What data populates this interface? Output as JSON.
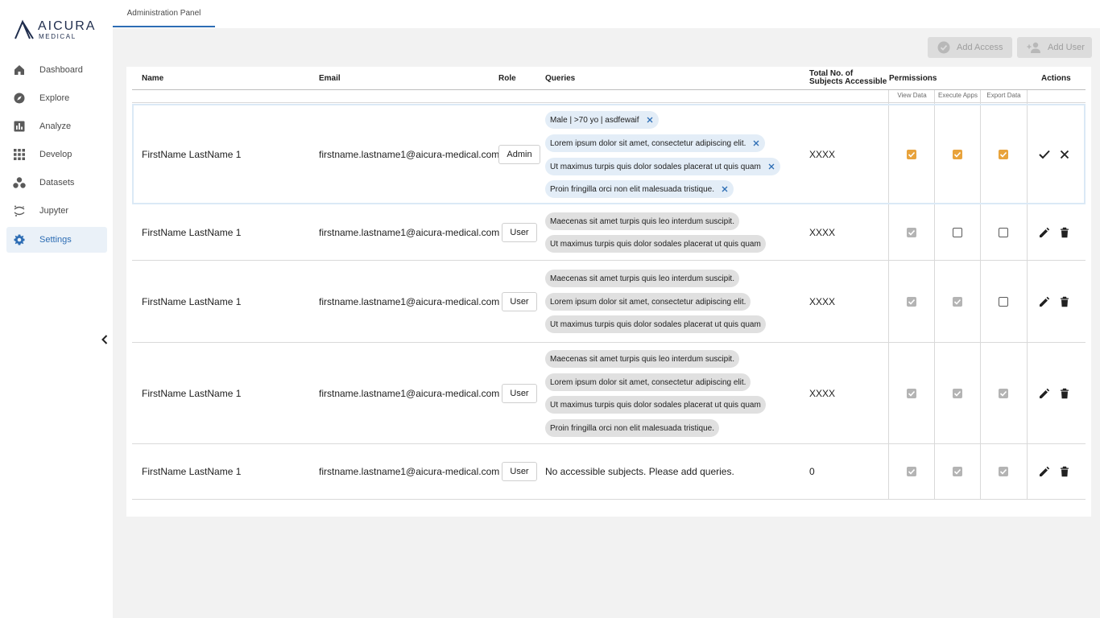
{
  "brand": {
    "line1": "AICURA",
    "line2": "MEDICAL"
  },
  "sidebar": {
    "items": [
      {
        "label": "Dashboard",
        "icon": "home-icon"
      },
      {
        "label": "Explore",
        "icon": "compass-icon"
      },
      {
        "label": "Analyze",
        "icon": "bar-chart-icon"
      },
      {
        "label": "Develop",
        "icon": "grid-icon"
      },
      {
        "label": "Datasets",
        "icon": "dots-cluster-icon"
      },
      {
        "label": "Jupyter",
        "icon": "jupyter-icon"
      },
      {
        "label": "Settings",
        "icon": "gear-icon",
        "active": true
      }
    ]
  },
  "tabs": [
    {
      "label": "Administration Panel",
      "active": true
    }
  ],
  "actions": {
    "add_access": "Add Access",
    "add_user": "Add User"
  },
  "table": {
    "columns": {
      "name": "Name",
      "email": "Email",
      "role": "Role",
      "queries": "Queries",
      "total_line1": "Total No. of",
      "total_line2": "Subjects Accessible",
      "permissions": "Permissions",
      "actions": "Actions"
    },
    "permission_columns": [
      "View Data",
      "Execute Apps",
      "Export Data"
    ],
    "rows": [
      {
        "name": "FirstName LastName 1",
        "email": "firstname.lastname1@aicura-medical.com",
        "role": "Admin",
        "queries": [
          "Male | >70 yo | asdfewaif",
          "Lorem ipsum dolor sit amet, consectetur adipiscing elit.",
          "Ut maximus turpis quis dolor sodales placerat ut quis quam",
          "Proin fringilla orci non elit malesuada tristique."
        ],
        "total": "XXXX",
        "permissions": [
          "checked",
          "checked",
          "checked"
        ],
        "editing": true
      },
      {
        "name": "FirstName LastName 1",
        "email": "firstname.lastname1@aicura-medical.com",
        "role": "User",
        "queries": [
          "Maecenas sit amet turpis quis leo interdum suscipit.",
          "Ut maximus turpis quis dolor sodales placerat ut quis quam"
        ],
        "total": "XXXX",
        "permissions": [
          "checked-disabled",
          "unchecked",
          "unchecked"
        ]
      },
      {
        "name": "FirstName LastName 1",
        "email": "firstname.lastname1@aicura-medical.com",
        "role": "User",
        "queries": [
          "Maecenas sit amet turpis quis leo interdum suscipit.",
          "Lorem ipsum dolor sit amet, consectetur adipiscing elit.",
          "Ut maximus turpis quis dolor sodales placerat ut quis quam"
        ],
        "total": "XXXX",
        "permissions": [
          "checked-disabled",
          "checked-disabled",
          "unchecked"
        ]
      },
      {
        "name": "FirstName LastName 1",
        "email": "firstname.lastname1@aicura-medical.com",
        "role": "User",
        "queries": [
          "Maecenas sit amet turpis quis leo interdum suscipit.",
          "Lorem ipsum dolor sit amet, consectetur adipiscing elit.",
          "Ut maximus turpis quis dolor sodales placerat ut quis quam",
          "Proin fringilla orci non elit malesuada tristique."
        ],
        "total": "XXXX",
        "permissions": [
          "checked-disabled",
          "checked-disabled",
          "checked-disabled"
        ]
      },
      {
        "name": "FirstName LastName 1",
        "email": "firstname.lastname1@aicura-medical.com",
        "role": "User",
        "queries": [],
        "empty_message": "No accessible subjects. Please add queries.",
        "total": "0",
        "permissions": [
          "checked-disabled",
          "checked-disabled",
          "checked-disabled"
        ]
      }
    ]
  },
  "colors": {
    "accent": "#2d6db4",
    "checkbox_active": "#e8a33c",
    "checkbox_disabled": "#b4b4b4",
    "chip": "#e0e0e0",
    "chip_editing": "#e3edf7"
  }
}
